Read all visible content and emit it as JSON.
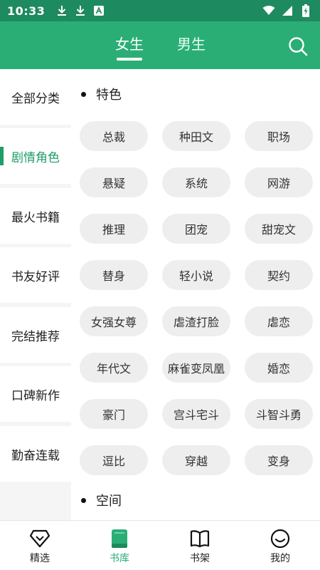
{
  "status_bar": {
    "time": "10:33",
    "left_icons": [
      "download-icon",
      "download-icon",
      "keyboard-a-icon"
    ],
    "right_icons": [
      "wifi-icon",
      "signal-icon",
      "battery-charging-icon"
    ]
  },
  "header": {
    "tabs": [
      {
        "label": "女生",
        "active": true
      },
      {
        "label": "男生",
        "active": false
      }
    ],
    "search_icon": "search-icon"
  },
  "sidebar": {
    "items": [
      {
        "label": "全部分类",
        "active": false
      },
      {
        "label": "剧情角色",
        "active": true
      },
      {
        "label": "最火书籍",
        "active": false
      },
      {
        "label": "书友好评",
        "active": false
      },
      {
        "label": "完结推荐",
        "active": false
      },
      {
        "label": "口碑新作",
        "active": false
      },
      {
        "label": "勤奋连载",
        "active": false
      }
    ]
  },
  "content": {
    "sections": [
      {
        "title": "特色",
        "tags": [
          "总裁",
          "种田文",
          "职场",
          "悬疑",
          "系统",
          "网游",
          "推理",
          "团宠",
          "甜宠文",
          "替身",
          "轻小说",
          "契约",
          "女强女尊",
          "虐渣打脸",
          "虐恋",
          "年代文",
          "麻雀变凤凰",
          "婚恋",
          "豪门",
          "宫斗宅斗",
          "斗智斗勇",
          "逗比",
          "穿越",
          "变身"
        ]
      },
      {
        "title": "空间",
        "tags": []
      }
    ]
  },
  "bottom_nav": {
    "items": [
      {
        "label": "精选",
        "icon": "diamond-icon",
        "active": false
      },
      {
        "label": "书库",
        "icon": "book-icon",
        "active": true
      },
      {
        "label": "书架",
        "icon": "open-book-icon",
        "active": false
      },
      {
        "label": "我的",
        "icon": "smiley-icon",
        "active": false
      }
    ]
  },
  "colors": {
    "status_bar": "#1e8a5f",
    "header": "#2bae76",
    "accent": "#1f9e67",
    "chip_bg": "#eeeeee",
    "sidebar_bg": "#f5f5f5"
  }
}
